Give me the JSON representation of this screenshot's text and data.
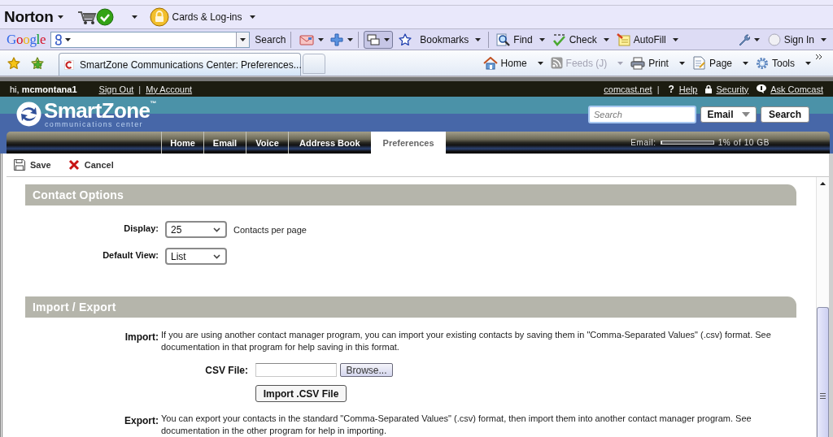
{
  "browser": {
    "norton_toolbar": {
      "logo": "Norton",
      "cards_menu": "Cards & Log-ins"
    },
    "google_toolbar": {
      "logo": "Google",
      "search_button": "Search",
      "items": [
        {
          "kind": "bookmarks",
          "label": "Bookmarks"
        },
        {
          "kind": "find",
          "label": "Find"
        },
        {
          "kind": "check",
          "label": "Check"
        },
        {
          "kind": "autofill",
          "label": "AutoFill"
        }
      ],
      "sign_in": "Sign In"
    },
    "tabs": [
      {
        "title": "SmartZone Communications Center: Preferences...",
        "selected": true
      }
    ],
    "command_bar": [
      {
        "kind": "home",
        "label": "Home",
        "disabled": false
      },
      {
        "kind": "feeds",
        "label": "Feeds (J)",
        "disabled": true
      },
      {
        "kind": "print",
        "label": "Print",
        "disabled": false
      },
      {
        "kind": "page",
        "label": "Page",
        "disabled": false
      },
      {
        "kind": "tools",
        "label": "Tools",
        "disabled": false
      }
    ]
  },
  "account_bar": {
    "greeting": "hi, **mcmontana1**",
    "left_links": [
      {
        "kind": "link",
        "text": "Sign Out"
      },
      {
        "kind": "separator",
        "text": "|"
      },
      {
        "kind": "link",
        "text": "My Account"
      }
    ],
    "right_links": [
      {
        "kind": "link",
        "text": "comcast.net"
      },
      {
        "kind": "separator",
        "text": "|"
      },
      {
        "kind": "help",
        "glyph": "?",
        "text": "Help"
      },
      {
        "kind": "lock",
        "text": "Security"
      },
      {
        "kind": "chat",
        "text": "Ask Comcast"
      }
    ]
  },
  "header": {
    "logo": "SmartZone$^{™}$",
    "tagline": "communications center",
    "search": {
      "placeholder": "Search"
    },
    "scope": "Email",
    "search_button": "Search"
  },
  "nav_tabs": [
    {
      "label": "Home",
      "selected": false
    },
    {
      "label": "Email",
      "selected": false
    },
    {
      "label": "Voice",
      "selected": false
    },
    {
      "label": "Address Book",
      "selected": false
    },
    {
      "label": "Preferences",
      "selected": true
    }
  ],
  "storage": {
    "label": "Email:",
    "level": 0.01,
    "reading": "1% of 10 GB"
  },
  "toolbar": [
    {
      "kind": "save",
      "label": "Save"
    },
    {
      "kind": "cancel",
      "label": "Cancel"
    }
  ],
  "contact_options": {
    "title": "Contact Options",
    "fields": [
      {
        "label": "Display:",
        "value": "25",
        "suffix": "Contacts per page"
      },
      {
        "label": "Default View:",
        "value": "List"
      }
    ]
  },
  "import_export": {
    "title": "Import / Export",
    "import": {
      "label": "Import:",
      "text": "If you are using another contact manager program, you can import your existing contacts by saving them in \"Comma-Separated Values\" (.csv) format. See documentation in that program for help saving in this format."
    },
    "csv_file": {
      "label": "CSV File:",
      "browse_button": "Browse..."
    },
    "import_button": "Import .CSV File",
    "export": {
      "label": "Export:",
      "text": "You can export your contacts in the standard \"Comma-Separated Values\" (.csv) format, then import them into another contact manager program. See documentation in the other program for help in importing."
    }
  }
}
